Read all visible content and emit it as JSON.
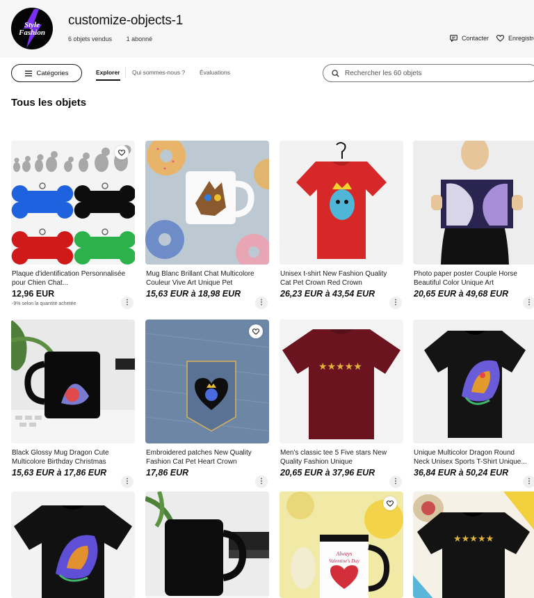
{
  "store": {
    "logo_line1": "Style",
    "logo_line2": "Fashion",
    "name": "customize-objects-1",
    "sold": "6 objets vendus",
    "followers": "1 abonné",
    "contact_label": "Contacter",
    "save_label": "Enregistrer"
  },
  "nav": {
    "categories_label": "Catégories",
    "tabs": [
      "Explorer",
      "Qui sommes-nous ?",
      "Évaluations"
    ],
    "active_tab": "Explorer",
    "search_placeholder": "Rechercher les 60 objets"
  },
  "section_title": "Tous les objets",
  "colors": {
    "accent": "#111111",
    "logo_purple": "#7b2ff2"
  },
  "products": [
    {
      "title": "Plaque d'identification Personnalisée pour Chien Chat...",
      "price": "12,96 EUR",
      "note": "-9% selon la quantité achetée",
      "favorite_icon": true
    },
    {
      "title": "Mug Blanc Brillant Chat Multicolore Couleur Vive Art Unique Pet",
      "price": "15,63 EUR à 18,98 EUR"
    },
    {
      "title": "Unisex t-shirt New Fashion Quality Cat Pet Crown Red Crown",
      "price": "26,23 EUR à 43,54 EUR"
    },
    {
      "title": "Photo paper poster Couple Horse Beautiful Color Unique Art",
      "price": "20,65 EUR à 49,68 EUR"
    },
    {
      "title": "Black Glossy Mug Dragon Cute Multicolore Birthday Christmas",
      "price": "15,63 EUR à 17,86 EUR"
    },
    {
      "title": "Embroidered patches New Quality Fashion Cat Pet Heart Crown",
      "price": "17,86 EUR",
      "favorite_icon": true
    },
    {
      "title": "Men's classic tee 5 Five stars New Quality Fashion Unique",
      "price": "20,65 EUR à 37,96 EUR"
    },
    {
      "title": "Unique Multicolor Dragon Round Neck Unisex Sports T-Shirt Unique...",
      "price": "36,84 EUR à 50,24 EUR"
    },
    {
      "title": "",
      "price": ""
    },
    {
      "title": "",
      "price": ""
    },
    {
      "title": "",
      "price": "",
      "favorite_icon": true,
      "mug_text": "Always Valentine's Day"
    },
    {
      "title": "",
      "price": ""
    }
  ],
  "icons": {
    "menu": "hamburger-icon",
    "search": "magnifier-icon",
    "contact": "message-icon",
    "save": "heart-icon",
    "more": "kebab-icon"
  }
}
